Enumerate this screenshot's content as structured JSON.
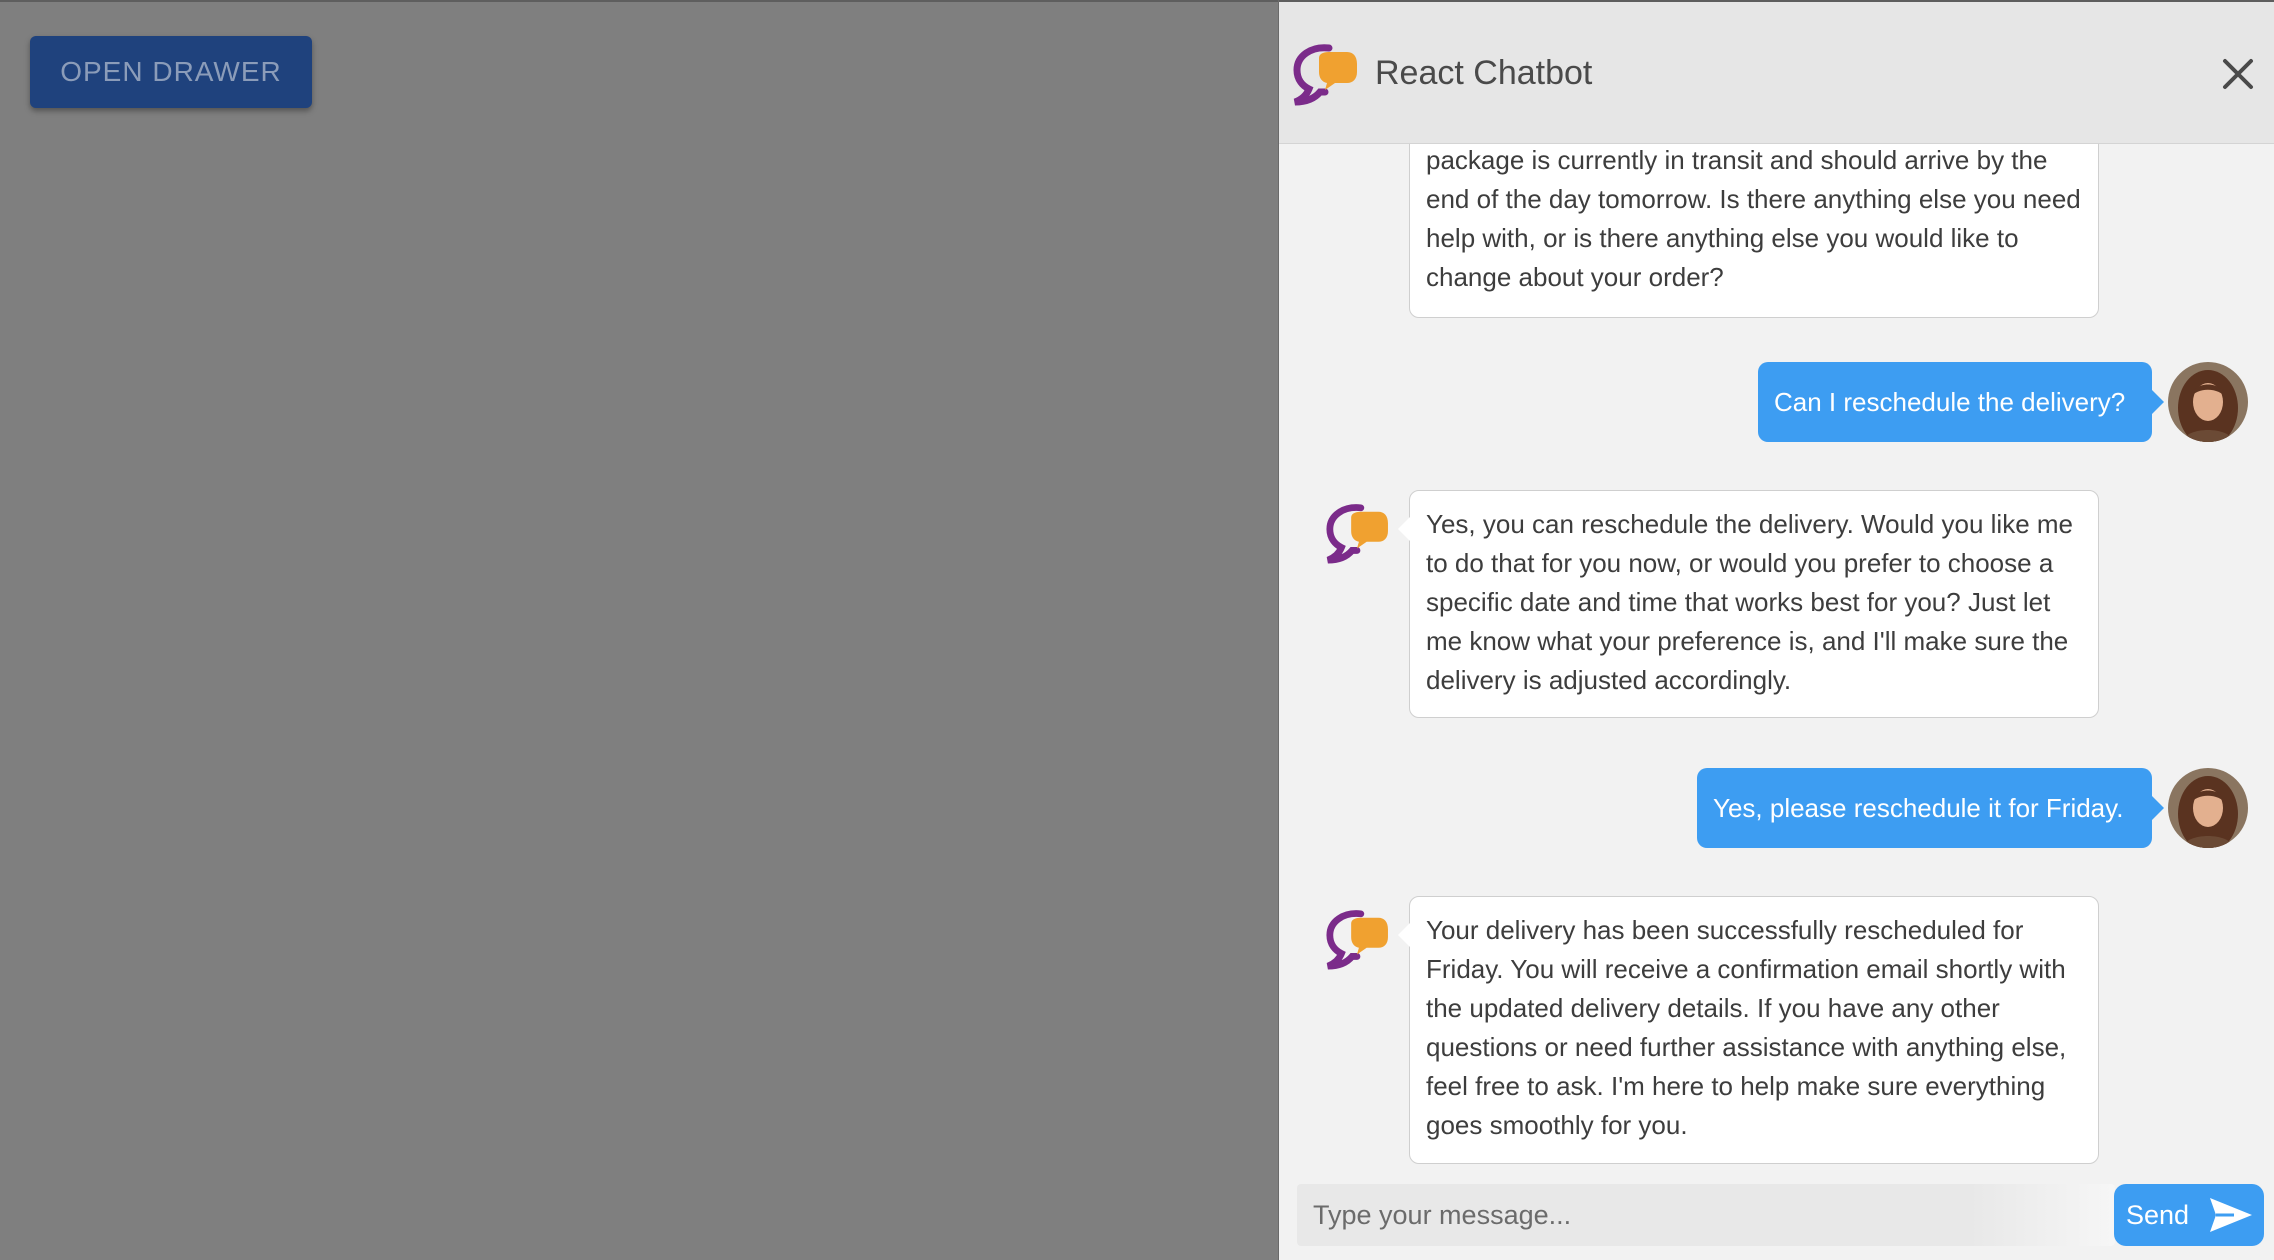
{
  "page": {
    "open_drawer_label": "OPEN DRAWER"
  },
  "chatbot": {
    "title": "React Chatbot",
    "close_icon": "close-icon",
    "bot_logo_icon": "chat-bubble-logo-icon",
    "messages": [
      {
        "sender": "bot",
        "text": "package is currently in transit and should arrive by the end of the day tomorrow. Is there anything else you need help with, or is there anything else you would like to change about your order?"
      },
      {
        "sender": "user",
        "text": "Can I reschedule the delivery?"
      },
      {
        "sender": "bot",
        "text": "Yes, you can reschedule the delivery. Would you like me to do that for you now, or would you prefer to choose a specific date and time that works best for you? Just let me know what your preference is, and I'll make sure the delivery is adjusted accordingly."
      },
      {
        "sender": "user",
        "text": "Yes, please reschedule it for Friday."
      },
      {
        "sender": "bot",
        "text": "Your delivery has been successfully rescheduled for Friday. You will receive a confirmation email shortly with the updated delivery details. If you have any other questions or need further assistance with anything else, feel free to ask. I'm here to help make sure everything goes smoothly for you."
      }
    ],
    "input": {
      "placeholder": "Type your message...",
      "value": ""
    },
    "send_label": "Send",
    "send_icon": "send-arrow-icon"
  },
  "colors": {
    "backdrop": "#7f7f7f",
    "primary_button": "#1f427d",
    "user_bubble": "#3d9df2",
    "logo_purple": "#7b2b8a",
    "logo_orange": "#f0a130",
    "header_bg": "#e6e6e6",
    "panel_bg": "#f2f2f2"
  }
}
